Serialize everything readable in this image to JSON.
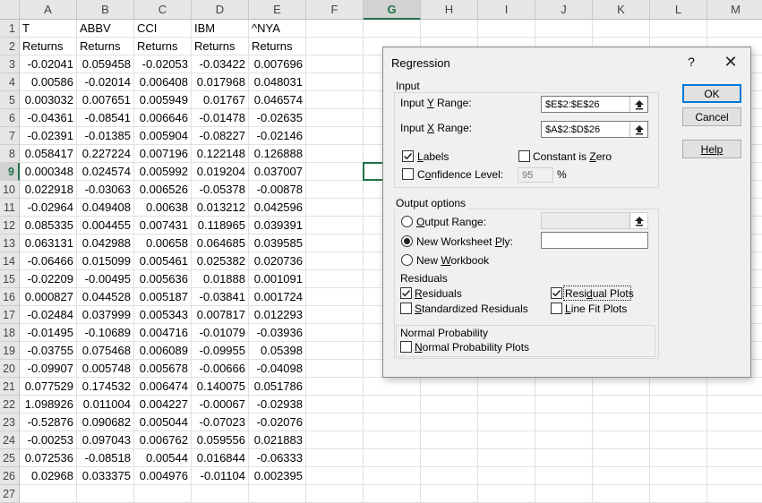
{
  "sheet": {
    "columns": [
      "A",
      "B",
      "C",
      "D",
      "E",
      "F",
      "G",
      "H",
      "I",
      "J",
      "K",
      "L",
      "M"
    ],
    "selected_cell": "G9",
    "header_row": [
      "T",
      "ABBV",
      "CCI",
      "IBM",
      "^NYA"
    ],
    "label_row": [
      "Returns",
      "Returns",
      "Returns",
      "Returns",
      "Returns"
    ],
    "rows": [
      [
        "-0.02041",
        "0.059458",
        "-0.02053",
        "-0.03422",
        "0.007696"
      ],
      [
        "0.00586",
        "-0.02014",
        "0.006408",
        "0.017968",
        "0.048031"
      ],
      [
        "0.003032",
        "0.007651",
        "0.005949",
        "0.01767",
        "0.046574"
      ],
      [
        "-0.04361",
        "-0.08541",
        "0.006646",
        "-0.01478",
        "-0.02635"
      ],
      [
        "-0.02391",
        "-0.01385",
        "0.005904",
        "-0.08227",
        "-0.02146"
      ],
      [
        "0.058417",
        "0.227224",
        "0.007196",
        "0.122148",
        "0.126888"
      ],
      [
        "0.000348",
        "0.024574",
        "0.005992",
        "0.019204",
        "0.037007"
      ],
      [
        "0.022918",
        "-0.03063",
        "0.006526",
        "-0.05378",
        "-0.00878"
      ],
      [
        "-0.02964",
        "0.049408",
        "0.00638",
        "0.013212",
        "0.042596"
      ],
      [
        "0.085335",
        "0.004455",
        "0.007431",
        "0.118965",
        "0.039391"
      ],
      [
        "0.063131",
        "0.042988",
        "0.00658",
        "0.064685",
        "0.039585"
      ],
      [
        "-0.06466",
        "0.015099",
        "0.005461",
        "0.025382",
        "0.020736"
      ],
      [
        "-0.02209",
        "-0.00495",
        "0.005636",
        "0.01888",
        "0.001091"
      ],
      [
        "0.000827",
        "0.044528",
        "0.005187",
        "-0.03841",
        "0.001724"
      ],
      [
        "-0.02484",
        "0.037999",
        "0.005343",
        "0.007817",
        "0.012293"
      ],
      [
        "-0.01495",
        "-0.10689",
        "0.004716",
        "-0.01079",
        "-0.03936"
      ],
      [
        "-0.03755",
        "0.075468",
        "0.006089",
        "-0.09955",
        "0.05398"
      ],
      [
        "-0.09907",
        "0.005748",
        "0.005678",
        "-0.00666",
        "-0.04098"
      ],
      [
        "0.077529",
        "0.174532",
        "0.006474",
        "0.140075",
        "0.051786"
      ],
      [
        "1.098926",
        "0.011004",
        "0.004227",
        "-0.00067",
        "-0.02938"
      ],
      [
        "-0.52876",
        "0.090682",
        "0.005044",
        "-0.07023",
        "-0.02076"
      ],
      [
        "-0.00253",
        "0.097043",
        "0.006762",
        "0.059556",
        "0.021883"
      ],
      [
        "0.072536",
        "-0.08518",
        "0.00544",
        "0.016844",
        "-0.06333"
      ],
      [
        "0.02968",
        "0.033375",
        "0.004976",
        "-0.01104",
        "0.002395"
      ]
    ]
  },
  "dialog": {
    "title": "Regression",
    "help_glyph": "?",
    "close_glyph": "✕",
    "input": {
      "group_label": "Input",
      "y_range_label": "Input Y Range:",
      "y_range_value": "$E$2:$E$26",
      "x_range_label": "Input X Range:",
      "x_range_value": "$A$2:$D$26",
      "labels_label": "Labels",
      "labels_checked": true,
      "constant_zero_label": "Constant is Zero",
      "constant_zero_checked": false,
      "confidence_label": "Confidence Level:",
      "confidence_checked": false,
      "confidence_value": "95",
      "percent": "%"
    },
    "output": {
      "group_label": "Output options",
      "output_range_label": "Output Range:",
      "new_worksheet_label": "New Worksheet Ply:",
      "new_workbook_label": "New Workbook",
      "selected": "new_worksheet"
    },
    "residuals": {
      "group_label": "Residuals",
      "residuals_label": "Residuals",
      "residuals_checked": true,
      "standardized_label": "Standardized Residuals",
      "standardized_checked": false,
      "residual_plots_label": "Residual Plots",
      "residual_plots_checked": true,
      "line_fit_label": "Line Fit Plots",
      "line_fit_checked": false
    },
    "normal": {
      "group_label": "Normal Probability",
      "plots_label": "Normal Probability Plots",
      "plots_checked": false
    },
    "buttons": {
      "ok": "OK",
      "cancel": "Cancel",
      "help": "Help"
    }
  }
}
